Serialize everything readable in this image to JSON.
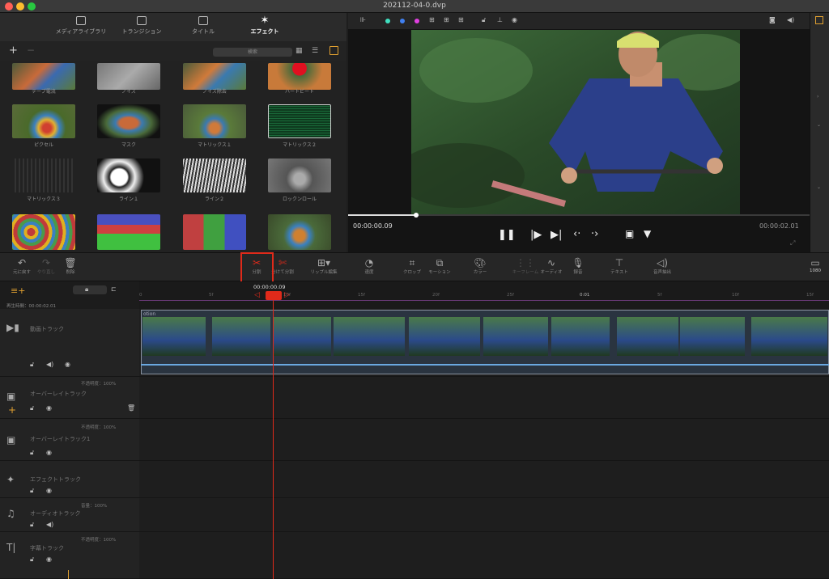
{
  "window": {
    "title": "202112-04-0.dvp"
  },
  "tabs": [
    {
      "label": "メディアライブラリ",
      "icon": "media-icon",
      "active": false
    },
    {
      "label": "トランジション",
      "icon": "transition-icon",
      "active": false
    },
    {
      "label": "タイトル",
      "icon": "title-icon",
      "active": false
    },
    {
      "label": "エフェクト",
      "icon": "effect-icon",
      "active": true
    }
  ],
  "search": {
    "placeholder": "検索"
  },
  "effects": [
    "テープ電流",
    "ノイズ",
    "ノイズ除去",
    "ハートビート",
    "ピクセル",
    "マスク",
    "マトリックス１",
    "マトリックス２",
    "マトリックス３",
    "ライン１",
    "ライン２",
    "ロックンロール",
    "",
    "",
    "",
    ""
  ],
  "preview": {
    "current_time": "00:00:00.09",
    "total_time": "00:00:02.01",
    "progress": 0.15
  },
  "toolbar": {
    "undo": "元に戻す",
    "redo": "やり直し",
    "delete": "削除",
    "split": "分割",
    "split_cut": "分けて分割",
    "ripple": "リップル編集",
    "speed": "速度",
    "crop": "クロップ",
    "motion": "モーション",
    "color": "カラー",
    "keyframe": "キーフレーム",
    "audio": "オーディオ",
    "record": "録音",
    "text": "テキスト",
    "voice": "音声抽出",
    "resolution": "1080"
  },
  "timeline": {
    "playback_label": "再生時間：00:00:02.01",
    "playhead_tc": "00:00:00.09",
    "ruler_ticks": [
      "0",
      "5f",
      "10f",
      "15f",
      "20f",
      "25f",
      "0:01",
      "5f",
      "10f",
      "15f"
    ],
    "clip_label": "otion",
    "tracks": [
      {
        "name": "動画トラック",
        "opacity": ""
      },
      {
        "name": "オーバーレイトラック",
        "opacity": "不透明度：100%"
      },
      {
        "name": "オーバーレイトラック1",
        "opacity": "不透明度：100%"
      },
      {
        "name": "エフェクトトラック",
        "opacity": ""
      },
      {
        "name": "オーディオトラック",
        "opacity": "音量：100%"
      },
      {
        "name": "字幕トラック",
        "opacity": "不透明度：100%"
      }
    ]
  },
  "colors": {
    "accent": "#e02a1a",
    "playhead": "#e02a1a",
    "ruler": "#6b3a7a",
    "clip_border": "#8a93a0"
  }
}
